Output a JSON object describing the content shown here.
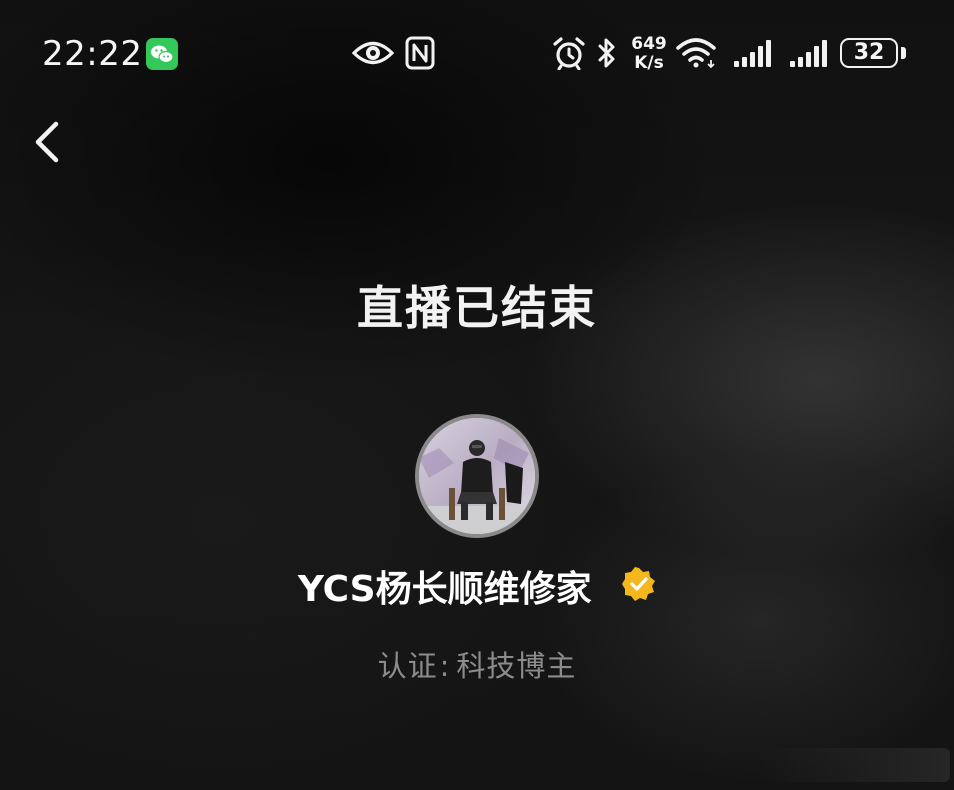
{
  "status_bar": {
    "time": "22:22",
    "network_speed_value": "649",
    "network_speed_unit": "K/s",
    "battery_level": "32",
    "icons": [
      "wechat-icon",
      "eye-icon",
      "nfc-icon",
      "alarm-icon",
      "bluetooth-icon",
      "wifi-icon",
      "signal-icon",
      "signal-icon",
      "battery-icon"
    ],
    "wechat_color": "#34c759"
  },
  "header": {
    "back_icon": "chevron-left-icon"
  },
  "main": {
    "title": "直播已结束",
    "streamer": {
      "name": "YCS杨长顺维修家",
      "verified_icon": "verified-badge-icon",
      "verified_color": "#f4b81c",
      "cert_label": "认证",
      "cert_separator": ":",
      "cert_value": "科技博主"
    }
  }
}
